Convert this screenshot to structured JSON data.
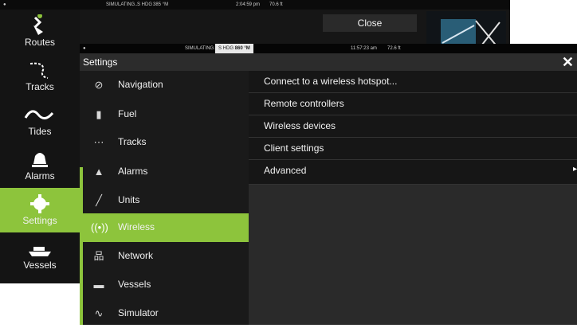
{
  "background": {
    "statusbar": {
      "mode": "SIMULATING...",
      "hdg_label": "S HDG",
      "hdg_value": "385 °M",
      "time": "2:04:59 pm",
      "depth": "70.6 ft"
    },
    "close_label": "Close"
  },
  "sidebar": {
    "items": [
      {
        "label": "Routes",
        "icon": "routes-icon"
      },
      {
        "label": "Tracks",
        "icon": "tracks-icon"
      },
      {
        "label": "Tides",
        "icon": "tides-icon"
      },
      {
        "label": "Alarms",
        "icon": "bell-icon"
      },
      {
        "label": "Settings",
        "icon": "gear-icon",
        "active": true
      },
      {
        "label": "Vessels",
        "icon": "vessels-icon"
      }
    ]
  },
  "settings": {
    "statusbar": {
      "mode": "SIMULATING...",
      "hdg_label": "S HDG",
      "hdg_value": "860 °M",
      "time": "11:57:23 am",
      "depth": "72.6 ft"
    },
    "title": "Settings",
    "close_glyph": "✕",
    "menu": [
      {
        "label": "Navigation",
        "icon": "compass-icon"
      },
      {
        "label": "Fuel",
        "icon": "fuel-pump-icon"
      },
      {
        "label": "Tracks",
        "icon": "tracks-icon"
      },
      {
        "label": "Alarms",
        "icon": "bell-icon"
      },
      {
        "label": "Units",
        "icon": "ruler-icon"
      },
      {
        "label": "Wireless",
        "icon": "wireless-icon",
        "active": true
      },
      {
        "label": "Network",
        "icon": "network-icon"
      },
      {
        "label": "Vessels",
        "icon": "vessels-icon"
      },
      {
        "label": "Simulator",
        "icon": "simulator-icon"
      }
    ],
    "panel": [
      {
        "label": "Connect to a wireless hotspot..."
      },
      {
        "label": "Remote controllers"
      },
      {
        "label": "Wireless devices"
      },
      {
        "label": "Client settings"
      },
      {
        "label": "Advanced",
        "chevron": "▸"
      }
    ]
  },
  "colors": {
    "accent": "#8dc43c",
    "panel_bg": "#2a2a2a",
    "menu_bg": "#1a1a1a",
    "item_bg": "#161616"
  }
}
